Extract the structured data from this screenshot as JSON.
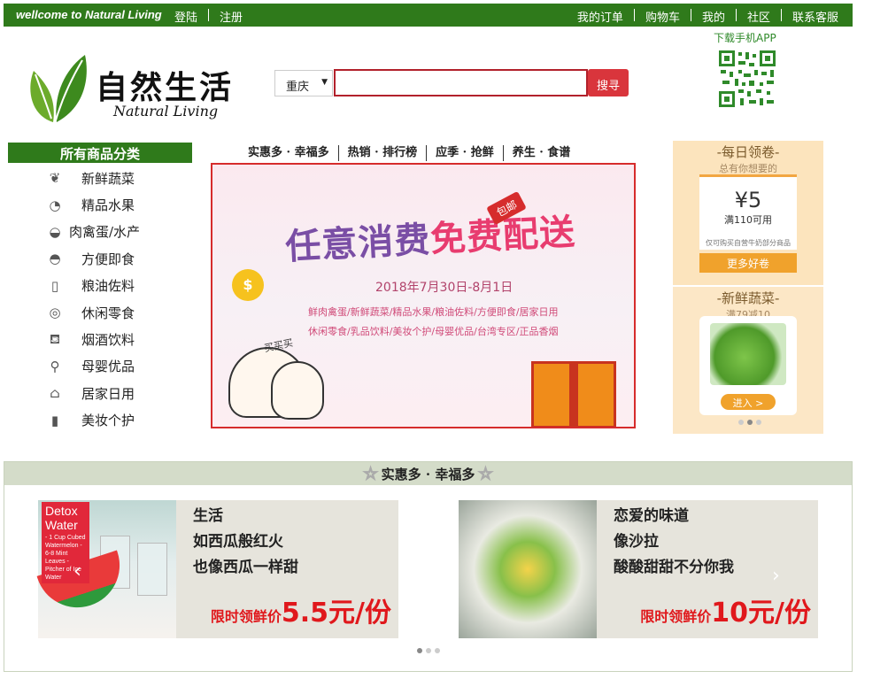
{
  "topbar": {
    "welcome": "wellcome to Natural Living",
    "login": "登陆",
    "register": "注册",
    "links": [
      "我的订单",
      "购物车",
      "我的",
      "社区",
      "联系客服"
    ]
  },
  "header": {
    "logo_title": "自然生活",
    "logo_sub": "Natural Living",
    "city": "重庆",
    "search_placeholder": "",
    "search_button": "搜寻",
    "app_label": "下载手机APP"
  },
  "categories": {
    "title": "所有商品分类",
    "items": [
      {
        "label": "新鲜蔬菜",
        "icon": "vegetable-icon"
      },
      {
        "label": "精品水果",
        "icon": "fruit-icon"
      },
      {
        "label": "肉禽蛋/水产",
        "icon": "meat-icon"
      },
      {
        "label": "方便即食",
        "icon": "bowl-icon"
      },
      {
        "label": "粮油佐料",
        "icon": "bottle-icon"
      },
      {
        "label": "休闲零食",
        "icon": "snack-icon"
      },
      {
        "label": "烟酒饮料",
        "icon": "drink-icon"
      },
      {
        "label": "母婴优品",
        "icon": "stroller-icon"
      },
      {
        "label": "居家日用",
        "icon": "home-icon"
      },
      {
        "label": "美妆个护",
        "icon": "cosmetic-icon"
      }
    ]
  },
  "tabs": [
    "实惠多 · 幸福多",
    "热销 · 排行榜",
    "应季 · 抢鲜",
    "养生 · 食谱"
  ],
  "banner": {
    "headline_a": "任意消费",
    "headline_b": "免费配送",
    "tag": "包邮",
    "date": "2018年7月30日-8月1日",
    "line1": "鲜肉禽蛋/新鲜蔬菜/精品水果/粮油佐料/方便即食/居家日用",
    "line2": "休闲零食/乳品饮料/美妆个护/母婴优品/台湾专区/正品香烟",
    "buy": "买买买"
  },
  "coupon": {
    "title": "-每日领卷-",
    "subtitle": "总有你想要的",
    "amount": "¥5",
    "condition": "满110可用",
    "note": "仅可购买自营牛奶部分商品",
    "more": "更多好卷"
  },
  "veg_ad": {
    "title": "-新鲜蔬菜-",
    "subtitle": "满79减10",
    "enter": "进入 >"
  },
  "promo": {
    "header": "实惠多 · 幸福多",
    "deals": [
      {
        "badge": "Detox Water",
        "badge_small": "- 1 Cup Cubed Watermelon - 6-8 Mint Leaves - Pitcher of Ice Water",
        "lines": [
          "生活",
          "如西瓜般红火",
          "也像西瓜一样甜"
        ],
        "price_prefix": "限时领鲜价",
        "price": "5.5元/份"
      },
      {
        "lines": [
          "恋爱的味道",
          "像沙拉",
          "酸酸甜甜不分你我"
        ],
        "price_prefix": "限时领鲜价",
        "price": "10元/份"
      }
    ]
  }
}
